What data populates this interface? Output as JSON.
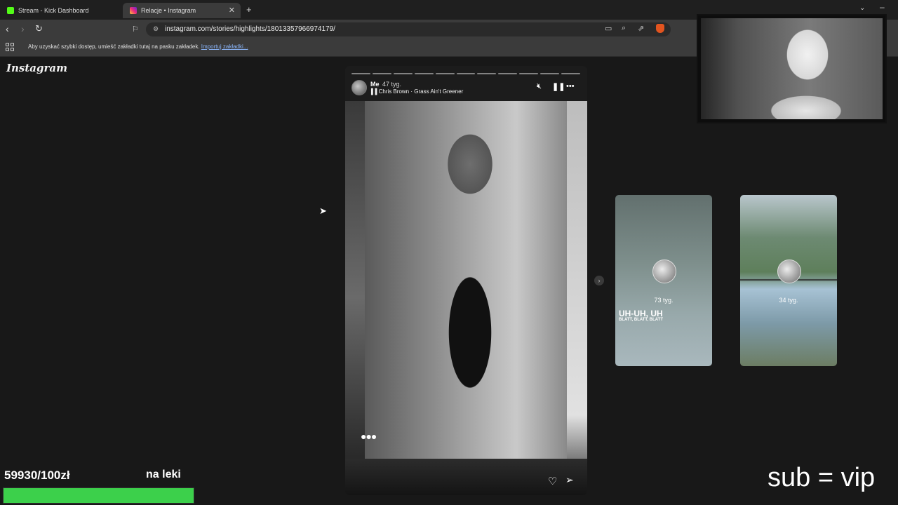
{
  "tabs": [
    {
      "title": "Stream - Kick Dashboard",
      "icon": "kick-favicon",
      "color": "#53fc18"
    },
    {
      "title": "Relacje • Instagram",
      "icon": "instagram-favicon",
      "color": "#d6249f",
      "active": true
    }
  ],
  "toolbar": {
    "url": "instagram.com/stories/highlights/18013357966974179/",
    "brave_badge": "1"
  },
  "bookmarks": {
    "hint": "Aby uzyskać szybki dostęp, umieść zakładki tutaj na pasku zakładek.",
    "import_link": "Importuj zakładki..."
  },
  "page": {
    "logo": "Instagram"
  },
  "story": {
    "username": "Me",
    "time": "47 tyg.",
    "music": "Chris Brown · Grass Ain't Greener",
    "segments": 11
  },
  "previews": [
    {
      "time": "73 tyg.",
      "text_main": "UH-UH, UH",
      "text_sub": "BLATT, BLATT, BLATT"
    },
    {
      "time": "34 tyg."
    }
  ],
  "overlay": {
    "donation_amount": "59930/100zł",
    "donation_goal_label": "na leki",
    "goal_progress": 1.0,
    "goal_color": "#3cd04b",
    "sub_text": "sub = vip"
  }
}
